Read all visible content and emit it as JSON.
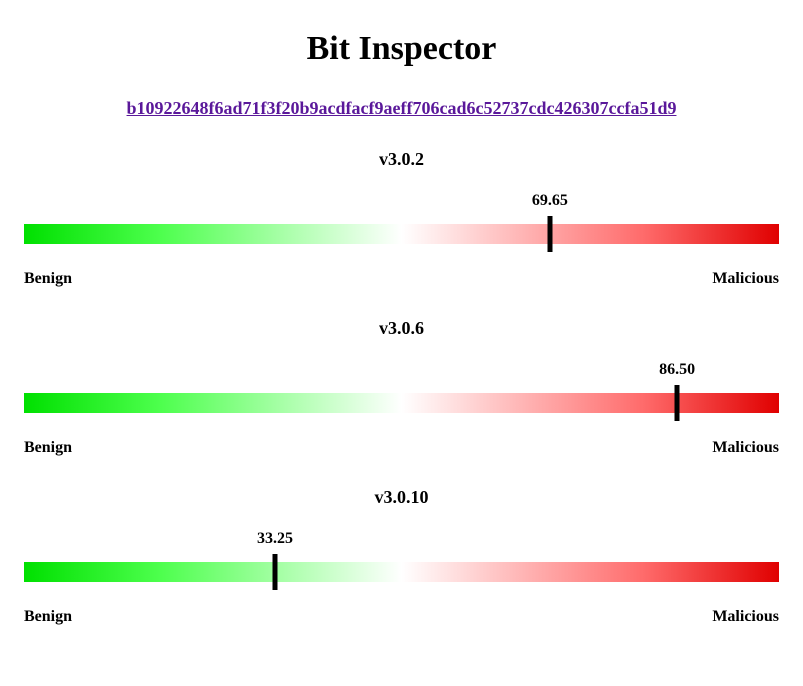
{
  "title": "Bit Inspector",
  "hash": "b10922648f6ad71f3f20b9acdfacf9aeff706cad6c52737cdc426307ccfa51d9",
  "axis": {
    "left": "Benign",
    "right": "Malicious"
  },
  "results": [
    {
      "version": "v3.0.2",
      "score": 69.65,
      "display": "69.65"
    },
    {
      "version": "v3.0.6",
      "score": 86.5,
      "display": "86.50"
    },
    {
      "version": "v3.0.10",
      "score": 33.25,
      "display": "33.25"
    }
  ],
  "chart_data": {
    "type": "bar",
    "title": "Bit Inspector",
    "xlabel": "Benign → Malicious",
    "ylabel": "",
    "ylim": [
      0,
      100
    ],
    "categories": [
      "v3.0.2",
      "v3.0.6",
      "v3.0.10"
    ],
    "values": [
      69.65,
      86.5,
      33.25
    ]
  }
}
